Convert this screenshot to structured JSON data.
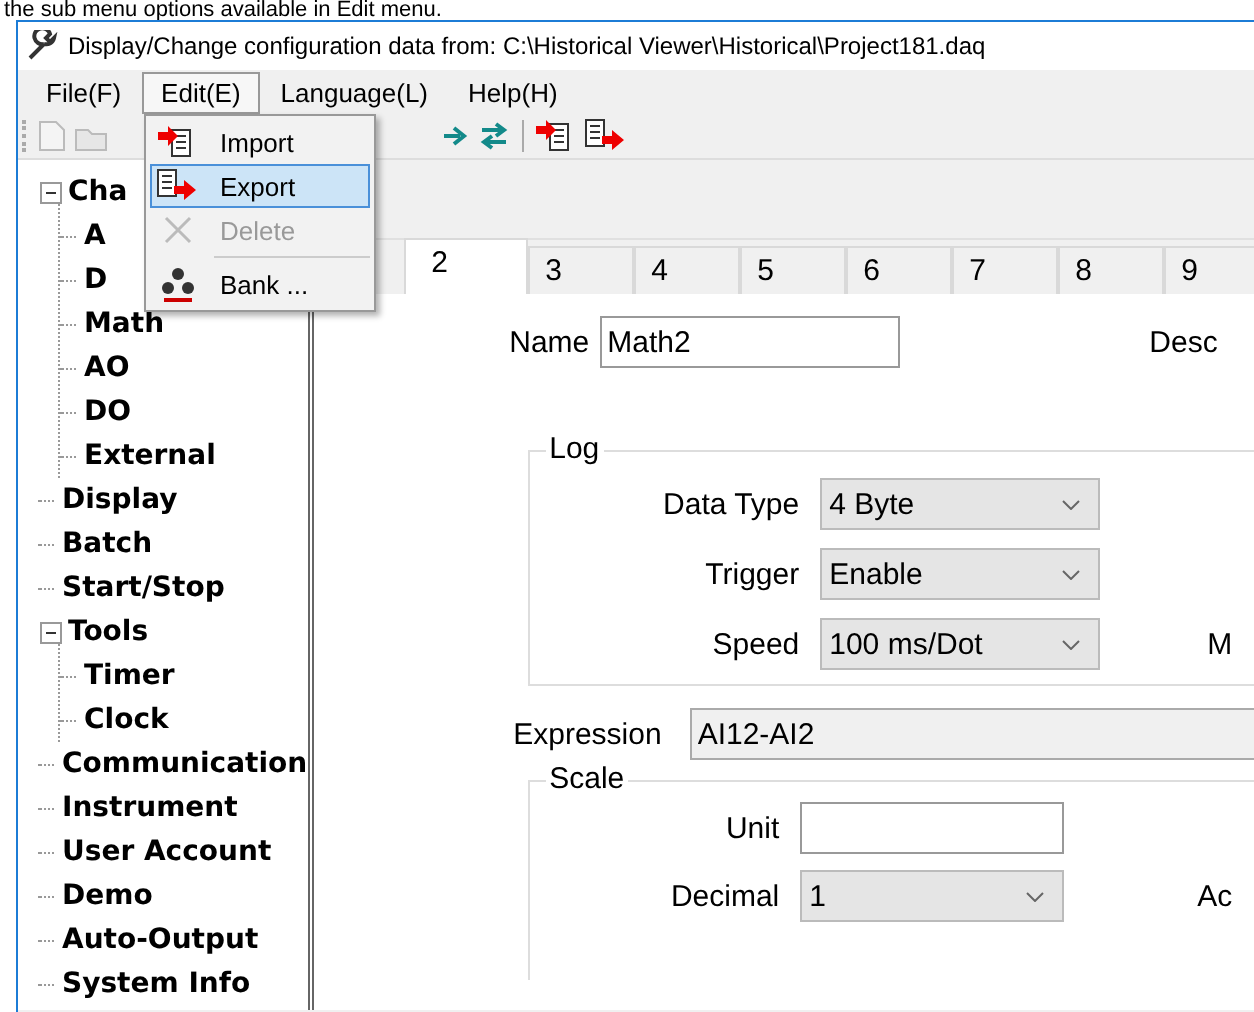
{
  "caption": "the sub menu options available in Edit menu.",
  "window": {
    "title": "Display/Change configuration data from: C:\\Historical Viewer\\Historical\\Project181.daq"
  },
  "menu_bar": [
    {
      "label": "File(F)",
      "selected": false
    },
    {
      "label": "Edit(E)",
      "selected": true
    },
    {
      "label": "Language(L)",
      "selected": false
    },
    {
      "label": "Help(H)",
      "selected": false
    }
  ],
  "edit_menu": [
    {
      "kind": "import",
      "label": "Import",
      "selected": false,
      "disabled": false
    },
    {
      "kind": "export",
      "label": "Export",
      "selected": true,
      "disabled": false
    },
    {
      "kind": "delete",
      "label": "Delete",
      "selected": false,
      "disabled": true
    },
    {
      "kind": "separator"
    },
    {
      "kind": "bank",
      "label": "Bank ...",
      "selected": false,
      "disabled": false
    }
  ],
  "tree": [
    {
      "label": "Cha",
      "expanded": true,
      "children": [
        {
          "label": "A"
        },
        {
          "label": "D"
        },
        {
          "label": "Math"
        },
        {
          "label": "AO"
        },
        {
          "label": "DO"
        },
        {
          "label": "External"
        }
      ]
    },
    {
      "label": "Display"
    },
    {
      "label": "Batch"
    },
    {
      "label": "Start/Stop"
    },
    {
      "label": "Tools",
      "expanded": true,
      "children": [
        {
          "label": "Timer"
        },
        {
          "label": "Clock"
        }
      ]
    },
    {
      "label": "Communication"
    },
    {
      "label": "Instrument"
    },
    {
      "label": "User Account"
    },
    {
      "label": "Demo"
    },
    {
      "label": "Auto-Output"
    },
    {
      "label": "System Info"
    }
  ],
  "tabs": [
    {
      "label": "2",
      "selected": true
    },
    {
      "label": "3",
      "selected": false
    },
    {
      "label": "4",
      "selected": false
    },
    {
      "label": "5",
      "selected": false
    },
    {
      "label": "6",
      "selected": false
    },
    {
      "label": "7",
      "selected": false
    },
    {
      "label": "8",
      "selected": false
    },
    {
      "label": "9",
      "selected": false
    }
  ],
  "form": {
    "name_label": "Name",
    "name_value": "Math2",
    "desc_label": "Desc",
    "log": {
      "title": "Log",
      "side_label": "M",
      "rows": [
        {
          "label": "Data Type",
          "value": "4 Byte"
        },
        {
          "label": "Trigger",
          "value": "Enable"
        },
        {
          "label": "Speed",
          "value": "100 ms/Dot"
        }
      ]
    },
    "expression_label": "Expression",
    "expression_value": "AI12-AI2",
    "scale": {
      "title": "Scale",
      "unit_label": "Unit",
      "decimal_label": "Decimal",
      "decimal_value": "1",
      "side_label": "Ac"
    }
  }
}
